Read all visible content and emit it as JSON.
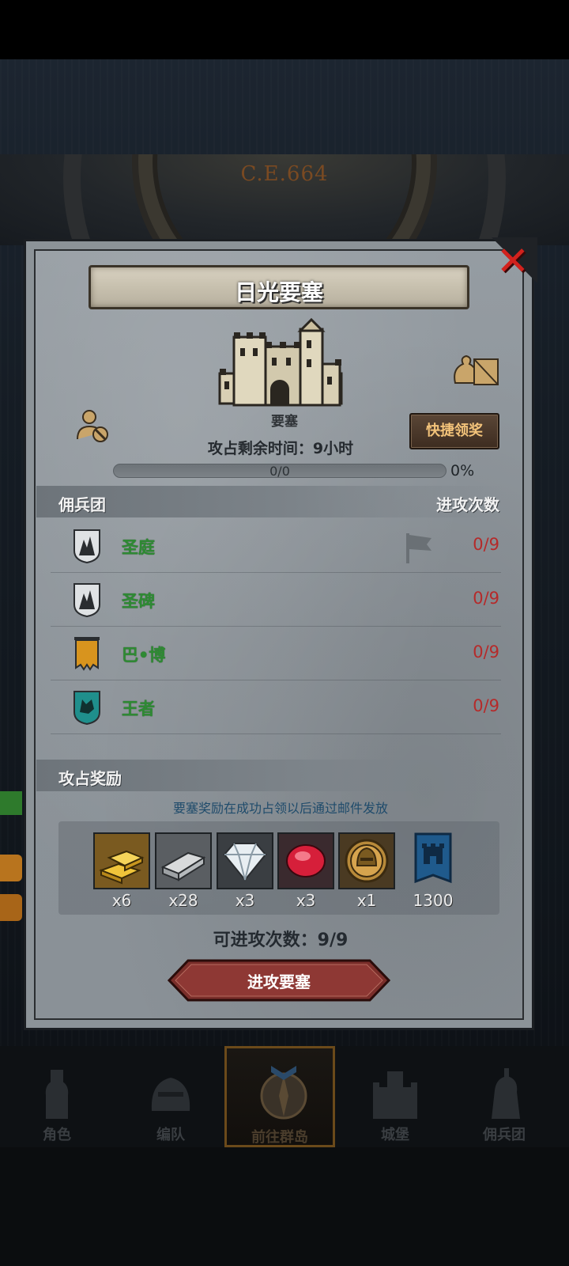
{
  "background": {
    "era_text": "C.E.664"
  },
  "dialog": {
    "title": "日光要塞",
    "fortress_label": "要塞",
    "quick_claim_label": "快捷领奖",
    "remaining_time": "攻占剩余时间：9小时",
    "progress": {
      "text": "0/0",
      "percent_label": "0%",
      "fraction": 0
    },
    "mercenary_section": {
      "title": "佣兵团",
      "column": "进攻次数"
    },
    "mercenaries": [
      {
        "name": "圣庭",
        "count": "0/9",
        "badge": "white-shield-icon"
      },
      {
        "name": "圣碑",
        "count": "0/9",
        "badge": "white-shield-icon"
      },
      {
        "name": "巴•博",
        "count": "0/9",
        "badge": "orange-banner-icon"
      },
      {
        "name": "王者",
        "count": "0/9",
        "badge": "teal-wolf-shield-icon"
      }
    ],
    "reward_section": {
      "title": "攻占奖励",
      "note": "要塞奖励在成功占领以后通过邮件发放"
    },
    "rewards": [
      {
        "item": "gold-bars-icon",
        "qty": "x6"
      },
      {
        "item": "iron-ingot-icon",
        "qty": "x28"
      },
      {
        "item": "diamond-icon",
        "qty": "x3"
      },
      {
        "item": "ruby-icon",
        "qty": "x3"
      },
      {
        "item": "knight-medal-icon",
        "qty": "x1"
      },
      {
        "item": "guild-banner-icon",
        "qty": "1300"
      }
    ],
    "attacks_left": "可进攻次数：9/9",
    "attack_button": "进攻要塞"
  },
  "nav": [
    {
      "label": "角色",
      "icon": "knight-icon"
    },
    {
      "label": "编队",
      "icon": "helmet-icon"
    },
    {
      "label": "前往群岛",
      "icon": "compass-icon",
      "active": true
    },
    {
      "label": "城堡",
      "icon": "castle-icon"
    },
    {
      "label": "佣兵团",
      "icon": "mercenary-icon"
    }
  ],
  "colors": {
    "accent_green": "#2e8a33",
    "count_red": "#b52a2a",
    "close_red": "#d2221d",
    "quick_text": "#f3c37a"
  }
}
